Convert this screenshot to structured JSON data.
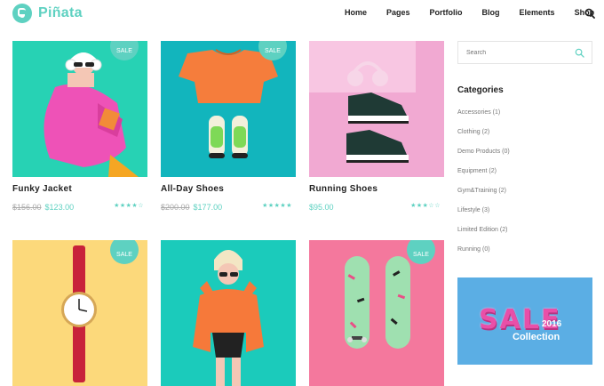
{
  "brand": {
    "name": "Piñata",
    "accent": "#5ed1c1"
  },
  "nav": [
    "Home",
    "Pages",
    "Portfolio",
    "Blog",
    "Elements",
    "Shop"
  ],
  "products": [
    {
      "name": "Funky Jacket",
      "sale": "SALE",
      "old_price": "$156.00",
      "price": "$123.00",
      "stars": "★★★★☆"
    },
    {
      "name": "All-Day Shoes",
      "sale": "SALE",
      "old_price": "$200.00",
      "price": "$177.00",
      "stars": "★★★★★"
    },
    {
      "name": "Running Shoes",
      "sale": "",
      "old_price": "",
      "price": "$95.00",
      "stars": "★★★☆☆"
    },
    {
      "name": "",
      "sale": "SALE"
    },
    {
      "name": "",
      "sale": ""
    },
    {
      "name": "",
      "sale": "SALE"
    }
  ],
  "sidebar": {
    "search_placeholder": "Search",
    "categories_title": "Categories",
    "categories": [
      "Accessories (1)",
      "Clothing (2)",
      "Demo Products (0)",
      "Equipment (2)",
      "Gym&Training (2)",
      "Lifestyle (3)",
      "Limited Edition (2)",
      "Running (0)"
    ],
    "banner": {
      "title": "SALE",
      "year": "2016",
      "subtitle": "Collection"
    }
  }
}
